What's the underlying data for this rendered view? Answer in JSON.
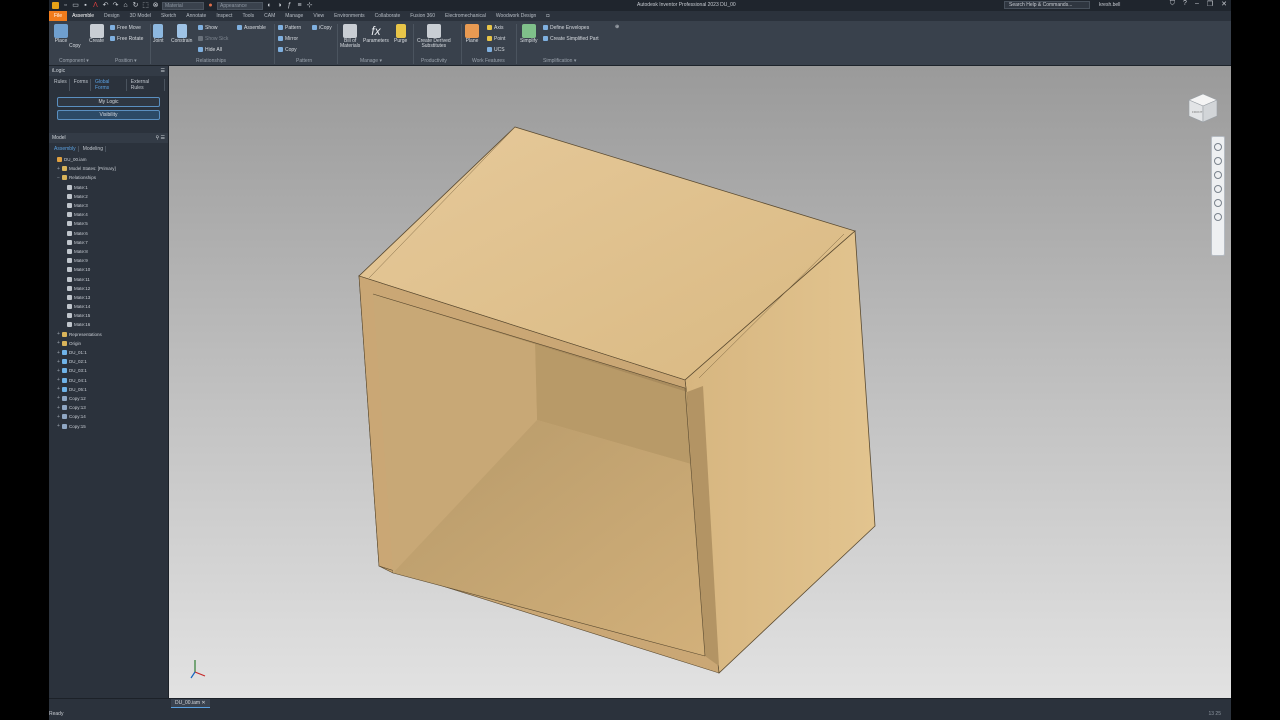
{
  "titlebar": {
    "style_combo": "Material",
    "appearance_combo": "Appearance",
    "title": "Autodesk Inventor Professional 2023    DU_00",
    "search": "Search Help & Commands...",
    "user": "kresh.bell"
  },
  "tabs": [
    "File",
    "Assemble",
    "Design",
    "3D Model",
    "Sketch",
    "Annotate",
    "Inspect",
    "Tools",
    "CAM",
    "Manage",
    "View",
    "Environments",
    "Collaborate",
    "Fusion 360",
    "Electromechanical",
    "Woodwork Design"
  ],
  "ribbon": {
    "place": "Place",
    "copy": "Copy",
    "create": "Create",
    "free_move": "Free Move",
    "free_rotate": "Free Rotate",
    "joint": "Joint",
    "constrain": "Constrain",
    "show": "Show",
    "show_sick": "Show Sick",
    "hide_all": "Hide All",
    "assemble": "Assemble",
    "pattern": "Pattern",
    "mirror": "Mirror",
    "copy_cmd": "Copy",
    "icopy": "iCopy",
    "bill_of": "Bill of",
    "materials": "Materials",
    "parameters": "Parameters",
    "purge": "Purge",
    "create_derived": "Create Derived",
    "substitutes": "Substitutes",
    "plane": "Plane",
    "axis": "Axis",
    "point": "Point",
    "ucs": "UCS",
    "simplify": "Simplify",
    "define_envelopes": "Define Envelopes",
    "create_simplified": "Create Simplified Part",
    "groups": {
      "component": "Component ▾",
      "position": "Position ▾",
      "relationships": "Relationships",
      "pattern": "Pattern",
      "manage": "Manage ▾",
      "productivity": "Productivity",
      "work_features": "Work Features",
      "simplification": "Simplification ▾"
    }
  },
  "logic_panel": {
    "title": "iLogic",
    "tabs": [
      "Rules",
      "Forms",
      "Global Forms",
      "External Rules"
    ],
    "buttons": [
      "My Logic",
      "Visibility"
    ]
  },
  "model_panel": {
    "title": "Model",
    "tabs": [
      "Assembly",
      "Modeling"
    ],
    "tree": [
      {
        "label": "DU_00.iam",
        "icon": "asm",
        "indent": 0,
        "exp": ""
      },
      {
        "label": "Model States: [Primary]",
        "icon": "fold",
        "indent": 1,
        "exp": "+"
      },
      {
        "label": "Relationships",
        "icon": "fold",
        "indent": 1,
        "exp": "−"
      },
      {
        "label": "Mate:1",
        "icon": "mate",
        "indent": 2,
        "exp": ""
      },
      {
        "label": "Mate:2",
        "icon": "mate",
        "indent": 2,
        "exp": ""
      },
      {
        "label": "Mate:3",
        "icon": "mate",
        "indent": 2,
        "exp": ""
      },
      {
        "label": "Mate:4",
        "icon": "mate",
        "indent": 2,
        "exp": ""
      },
      {
        "label": "Mate:5",
        "icon": "mate",
        "indent": 2,
        "exp": ""
      },
      {
        "label": "Mate:6",
        "icon": "mate",
        "indent": 2,
        "exp": ""
      },
      {
        "label": "Mate:7",
        "icon": "mate",
        "indent": 2,
        "exp": ""
      },
      {
        "label": "Mate:8",
        "icon": "mate",
        "indent": 2,
        "exp": ""
      },
      {
        "label": "Mate:9",
        "icon": "mate",
        "indent": 2,
        "exp": ""
      },
      {
        "label": "Mate:10",
        "icon": "mate",
        "indent": 2,
        "exp": ""
      },
      {
        "label": "Mate:11",
        "icon": "mate",
        "indent": 2,
        "exp": ""
      },
      {
        "label": "Mate:12",
        "icon": "mate",
        "indent": 2,
        "exp": ""
      },
      {
        "label": "Mate:13",
        "icon": "mate",
        "indent": 2,
        "exp": ""
      },
      {
        "label": "Mate:14",
        "icon": "mate",
        "indent": 2,
        "exp": ""
      },
      {
        "label": "Mate:15",
        "icon": "mate",
        "indent": 2,
        "exp": ""
      },
      {
        "label": "Mate:16",
        "icon": "mate",
        "indent": 2,
        "exp": ""
      },
      {
        "label": "Representations",
        "icon": "fold",
        "indent": 1,
        "exp": "+"
      },
      {
        "label": "Origin",
        "icon": "fold",
        "indent": 1,
        "exp": "+"
      },
      {
        "label": "DU_01:1",
        "icon": "part",
        "indent": 1,
        "exp": "+"
      },
      {
        "label": "DU_02:1",
        "icon": "part",
        "indent": 1,
        "exp": "+"
      },
      {
        "label": "DU_03:1",
        "icon": "part",
        "indent": 1,
        "exp": "+"
      },
      {
        "label": "DU_04:1",
        "icon": "part",
        "indent": 1,
        "exp": "+"
      },
      {
        "label": "DU_05:1",
        "icon": "part",
        "indent": 1,
        "exp": "+"
      },
      {
        "label": "Copy:12",
        "icon": "copy",
        "indent": 1,
        "exp": "+"
      },
      {
        "label": "Copy:13",
        "icon": "copy",
        "indent": 1,
        "exp": "+"
      },
      {
        "label": "Copy:14",
        "icon": "copy",
        "indent": 1,
        "exp": "+"
      },
      {
        "label": "Copy:15",
        "icon": "copy",
        "indent": 1,
        "exp": "+"
      }
    ]
  },
  "viewcube_label": "FRONT",
  "doc_tab": "DU_00.iam",
  "status": "Ready",
  "status_right": "13     25"
}
